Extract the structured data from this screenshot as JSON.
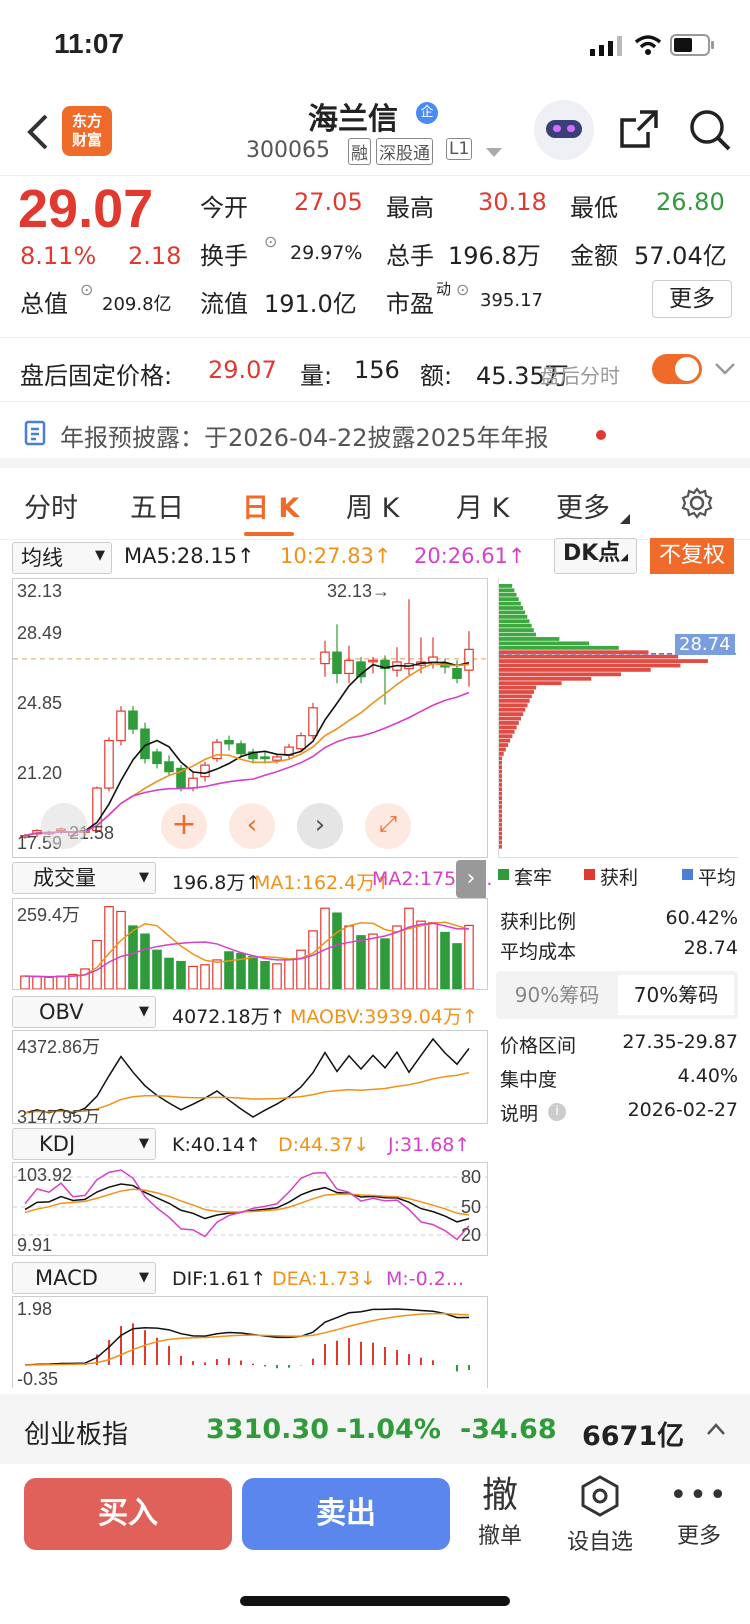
{
  "status": {
    "time": "11:07"
  },
  "header": {
    "name": "海兰信",
    "code": "300065",
    "badges": [
      "融",
      "深股通",
      "L1"
    ],
    "logo_text": "东方\n财富",
    "badge_qi": "企"
  },
  "quote": {
    "price": "29.07",
    "pct": "8.11%",
    "chg": "2.18",
    "open_label": "今开",
    "open": "27.05",
    "high_label": "最高",
    "high": "30.18",
    "low_label": "最低",
    "low": "26.80",
    "turnover_label": "换手",
    "turnover": "29.97%",
    "volume_label": "总手",
    "volume": "196.8万",
    "amount_label": "金额",
    "amount": "57.04亿",
    "mcap_label": "总值",
    "mcap": "209.8亿",
    "float_label": "流值",
    "float": "191.0亿",
    "pe_label": "市盈",
    "pe_sup": "动",
    "pe": "395.17",
    "more": "更多"
  },
  "afterhours": {
    "label": "盘后固定价格:",
    "price": "29.07",
    "vol_label": "量:",
    "vol": "156",
    "amt_label": "额:",
    "amt": "45.35万",
    "overlay": "盘后分时"
  },
  "notice": {
    "text": "年报预披露：于2026-04-22披露2025年年报"
  },
  "tabs": [
    "分时",
    "五日",
    "日 K",
    "周 K",
    "月 K",
    "更多"
  ],
  "chart": {
    "ma_select": "均线",
    "ma5": "MA5:28.15↑",
    "ma10": "10:27.83↑",
    "ma20": "20:26.61↑",
    "dk": "DK点",
    "fq": "不复权",
    "y_labels": [
      "32.13",
      "28.49",
      "24.85",
      "21.20"
    ],
    "bottom_label": "17.59",
    "max_annot": "32.13→",
    "low_annot": "21.58",
    "cost_tag": "28.74"
  },
  "vol": {
    "select": "成交量",
    "v": "196.8万↑",
    "ma1": "MA1:162.4万↑",
    "ma2": "MA2:175.5...",
    "ymax": "259.4万"
  },
  "obv": {
    "select": "OBV",
    "v": "4072.18万↑",
    "ma": "MAOBV:3939.04万↑",
    "ymax": "4372.86万",
    "ymin": "3147.95万"
  },
  "kdj": {
    "select": "KDJ",
    "k": "K:40.14↑",
    "d": "D:44.37↓",
    "j": "J:31.68↑",
    "ymax": "103.92",
    "ymin": "9.91",
    "r80": "80",
    "r50": "50",
    "r20": "20"
  },
  "macd": {
    "select": "MACD",
    "dif": "DIF:1.61↑",
    "dea": "DEA:1.73↓",
    "m": "M:-0.2...",
    "ymax": "1.98",
    "ymin": "-0.35"
  },
  "chips": {
    "legend": [
      "套牢",
      "获利",
      "平均"
    ],
    "profit_label": "获利比例",
    "profit": "60.42%",
    "cost_label": "平均成本",
    "cost": "28.74",
    "tab90": "90%筹码",
    "tab70": "70%筹码",
    "range_label": "价格区间",
    "range": "27.35-29.87",
    "conc_label": "集中度",
    "conc": "4.40%",
    "note_label": "说明",
    "note": "2026-02-27"
  },
  "index": {
    "name": "创业板指",
    "value": "3310.30",
    "pct": "-1.04%",
    "chg": "-34.68",
    "amt": "6671亿"
  },
  "bottom": {
    "buy": "买入",
    "sell": "卖出",
    "cancel_icon": "撤",
    "cancel": "撤单",
    "watch": "设自选",
    "more": "更多"
  },
  "colors": {
    "up": "#e03a30",
    "down": "#2f9b3a",
    "ma10": "#f0921a",
    "ma20": "#d640c8",
    "accent": "#f06a2a"
  },
  "kline": {
    "o": [
      17.6,
      17.8,
      17.9,
      18.0,
      17.7,
      17.9,
      18.0,
      20.6,
      23.5,
      25.3,
      24.2,
      22.8,
      22.2,
      21.8,
      20.6,
      21.3,
      22.4,
      23.5,
      23.3,
      22.8,
      22.5,
      22.3,
      22.6,
      23.0,
      23.8,
      28.2,
      28.9,
      27.6,
      28.3,
      28.4,
      28.4,
      27.8,
      27.9,
      28.1,
      28.3,
      28.2,
      27.9,
      27.8
    ],
    "c": [
      17.7,
      18.0,
      17.9,
      18.1,
      17.9,
      18.0,
      20.6,
      23.5,
      25.3,
      24.2,
      22.4,
      22.1,
      21.6,
      20.6,
      21.2,
      22.0,
      23.4,
      23.3,
      22.7,
      22.4,
      22.4,
      22.5,
      23.1,
      23.8,
      25.5,
      28.9,
      27.6,
      28.4,
      27.4,
      28.4,
      27.9,
      28.3,
      28.2,
      28.3,
      28.6,
      28.0,
      27.3,
      29.07
    ],
    "h": [
      17.8,
      18.1,
      18.0,
      18.2,
      18.0,
      18.1,
      20.7,
      23.7,
      25.6,
      25.6,
      24.6,
      23.0,
      22.6,
      22.0,
      21.6,
      22.2,
      23.6,
      23.8,
      23.5,
      23.0,
      22.8,
      22.7,
      23.3,
      24.0,
      25.8,
      29.6,
      30.6,
      29.3,
      28.6,
      28.6,
      28.7,
      29.2,
      32.13,
      29.8,
      29.8,
      28.5,
      28.4,
      30.18
    ],
    "l": [
      17.5,
      17.6,
      17.7,
      17.8,
      17.6,
      17.7,
      17.9,
      20.4,
      23.2,
      23.9,
      22.1,
      21.8,
      21.4,
      20.4,
      20.4,
      21.0,
      22.2,
      22.9,
      22.5,
      22.1,
      22.1,
      22.1,
      22.4,
      22.9,
      23.6,
      27.4,
      27.0,
      27.0,
      27.0,
      27.6,
      25.7,
      27.4,
      27.5,
      27.6,
      27.9,
      27.6,
      27.0,
      26.8
    ]
  },
  "volumes": [
    40,
    38,
    36,
    40,
    45,
    62,
    150,
    255,
    240,
    195,
    170,
    120,
    95,
    85,
    70,
    75,
    90,
    115,
    110,
    100,
    85,
    78,
    92,
    120,
    180,
    250,
    235,
    195,
    165,
    170,
    155,
    195,
    250,
    210,
    205,
    175,
    140,
    196.8
  ]
}
